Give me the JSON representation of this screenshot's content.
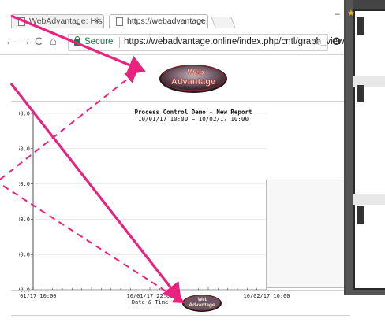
{
  "browser": {
    "tabs": [
      {
        "label": "WebAdvantage: History o"
      },
      {
        "label": "https://webadvantage.onl"
      }
    ],
    "address": {
      "secure_label": "Secure",
      "url": "https://webadvantage.online/index.php/cntl/graph_view"
    },
    "icons": {
      "back": "←",
      "forward": "→",
      "reload": "C",
      "home": "⌂",
      "star": "☆",
      "close": "×",
      "minimize": "–",
      "extension": "O"
    }
  },
  "page": {
    "logo_line1": "Web",
    "logo_line2": "Advantage",
    "footer_logo_line1": "Web",
    "footer_logo_line2": "Advantage"
  },
  "chart_data": {
    "type": "line",
    "title": "Process Control Demo - New Report",
    "subtitle": "10/01/17 10:00 ~ 10/02/17 10:00",
    "xlabel": "Date & Time",
    "ylabel": "",
    "ylim": [
      100,
      800
    ],
    "y_ticks": [
      "800.0",
      "660.0",
      "520.0",
      "380.0",
      "240.0",
      "100.0"
    ],
    "x_ticks": [
      "10/01/17 10:00",
      "10/01/17 22:00",
      "10/02/17 10:00"
    ],
    "series": [],
    "grid": true
  },
  "colors": {
    "arrow": "#e8227e",
    "secure": "#0b8043",
    "panel": "#555555"
  }
}
